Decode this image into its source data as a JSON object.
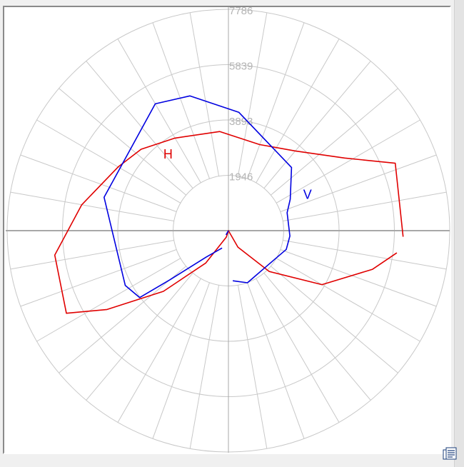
{
  "chart_data": {
    "type": "polar",
    "title": "",
    "radial_ticks": [
      "1946",
      "3893",
      "5839",
      "7786"
    ],
    "rmax": 7786,
    "angular_step_deg": 10,
    "grid": true,
    "series": [
      {
        "label": "H",
        "color": "#e00000",
        "points": [
          [
            -82.5,
            5975
          ],
          [
            -75,
            5250
          ],
          [
            -60,
            3800
          ],
          [
            -45,
            2030
          ],
          [
            -30,
            670
          ],
          [
            0,
            0
          ],
          [
            18,
            240
          ],
          [
            35,
            1390
          ],
          [
            47,
            3130
          ],
          [
            57,
            5090
          ],
          [
            63,
            6400
          ],
          [
            82,
            6170
          ],
          [
            100,
            5240
          ],
          [
            120,
            4480
          ],
          [
            133,
            4200
          ],
          [
            150,
            3760
          ],
          [
            175,
            3500
          ],
          [
            200,
            3220
          ],
          [
            220,
            3660
          ],
          [
            238,
            4820
          ],
          [
            248,
            6330
          ],
          [
            272,
            6150
          ]
        ],
        "label_angle": 138,
        "label_r": 3420
      },
      {
        "label": "V",
        "color": "#0000e0",
        "points": [
          [
            20,
            650
          ],
          [
            40,
            1210
          ],
          [
            50,
            2700
          ],
          [
            53,
            3910
          ],
          [
            62,
            4110
          ],
          [
            105,
            4530
          ],
          [
            150,
            5150
          ],
          [
            164,
            4930
          ],
          [
            185,
            4180
          ],
          [
            225,
            3140
          ],
          [
            243,
            2440
          ],
          [
            253,
            2160
          ],
          [
            275,
            2170
          ],
          [
            288,
            2140
          ],
          [
            310,
            1850
          ],
          [
            340,
            1950
          ],
          [
            355,
            1770
          ]
        ],
        "segment_to_origin": [
          30,
          170
        ],
        "label_angle": 247,
        "label_r": 2860
      }
    ]
  },
  "toolbar": {
    "doc_icon": "document-list-icon"
  }
}
